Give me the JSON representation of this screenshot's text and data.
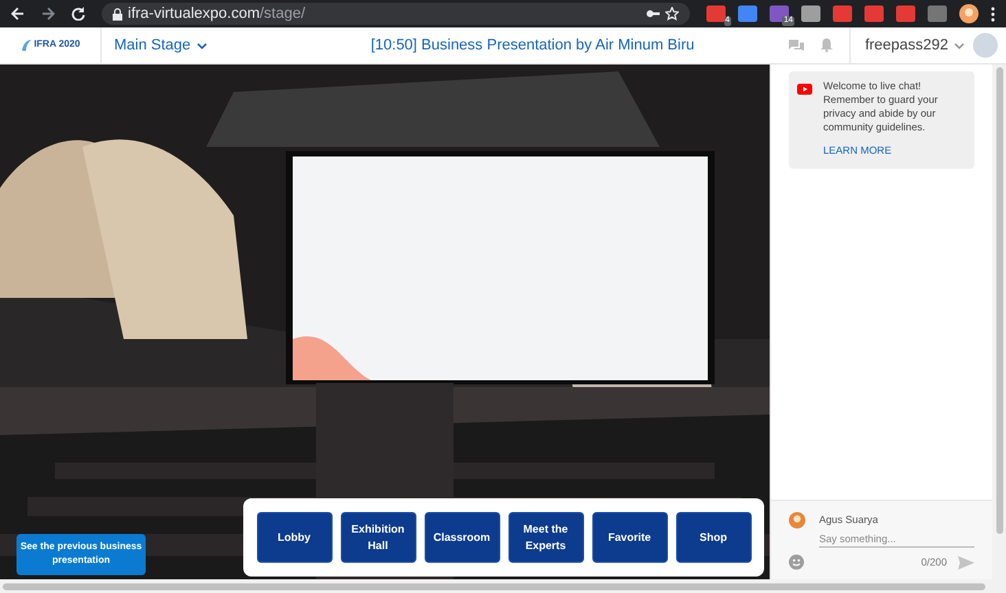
{
  "browser": {
    "url_host": "ifra-virtualexpo.com",
    "url_path": "/stage/",
    "extensions": [
      {
        "color": "#e53935",
        "badge": "4"
      },
      {
        "color": "#4285f4"
      },
      {
        "color": "#7e57c2",
        "badge": "14"
      },
      {
        "color": "#9e9e9e"
      },
      {
        "color": "#e53935"
      },
      {
        "color": "#e53935"
      },
      {
        "color": "#e53935"
      },
      {
        "color": "#757575"
      }
    ]
  },
  "header": {
    "logo_text": "IFRA 2020",
    "stage_menu": "Main Stage",
    "session_title": "[10:50] Business Presentation by Air Minum Biru",
    "user": "freepass292"
  },
  "stage": {
    "kind": "picture",
    "previous_button": "See the previous business presentation",
    "nav_buttons": [
      "Lobby",
      "Exhibition Hall",
      "Classroom",
      "Meet the Experts",
      "Favorite",
      "Shop"
    ]
  },
  "chat": {
    "notice": "Welcome to live chat! Remember to guard your privacy and abide by our community guidelines.",
    "notice_link": "LEARN MORE",
    "composer": {
      "author": "Agus Suarya",
      "placeholder": "Say something...",
      "counter": "0/200"
    }
  }
}
